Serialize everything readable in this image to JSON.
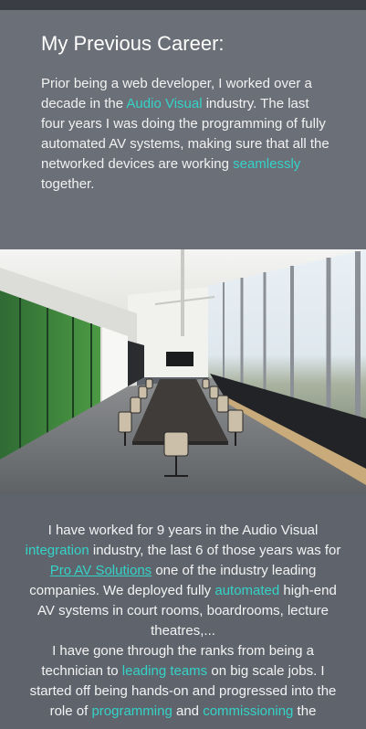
{
  "career": {
    "heading": "My Previous Career:",
    "p1_a": "Prior being a web developer, I worked over a decade in the ",
    "p1_link1": "Audio Visual",
    "p1_b": " industry. The last four years I was doing the programming of fully automated AV systems, making sure that all the networked devices are working ",
    "p1_link2": "seamlessly",
    "p1_c": " together."
  },
  "image": {
    "alt": "Conference room with a long table, chairs, a wall-mounted TV and floor-to-ceiling windows"
  },
  "about": {
    "s1": "I have worked for 9 years in the Audio Visual ",
    "l1": "integration",
    "s2": " industry, the last 6 of those years was for ",
    "l2": "Pro AV Solutions",
    "s3": " one of the industry leading companies. We deployed fully ",
    "l3": "automated",
    "s4": " high-end AV systems in court rooms, boardrooms, lecture theatres,...",
    "s5": "I have gone through the ranks from being a technician to ",
    "l4": "leading teams",
    "s6": " on big scale jobs. I started off being hands-on and progressed into the role of ",
    "l5": "programming",
    "s7": " and ",
    "l6": "commissioning",
    "s8": " the"
  },
  "colors": {
    "accent": "#34d3c8",
    "panel": "#6b6f77",
    "background": "#5f646c"
  }
}
